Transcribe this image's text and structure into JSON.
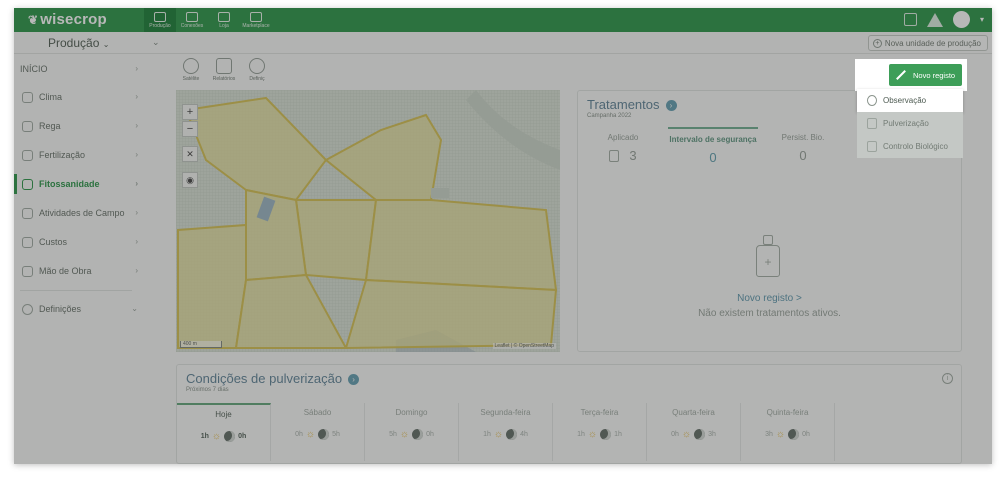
{
  "app": {
    "logo": "wisecrop",
    "nav": [
      {
        "label": "Produção",
        "icon": "home-icon"
      },
      {
        "label": "Conexões",
        "icon": "network-icon"
      },
      {
        "label": "Loja",
        "icon": "shop-icon"
      },
      {
        "label": "Marketplace",
        "icon": "marketplace-icon"
      }
    ]
  },
  "subbar": {
    "production_label": "Produção",
    "new_unit_label": "Nova unidade de produção"
  },
  "sidebar": {
    "inicio": "INÍCIO",
    "items": [
      {
        "label": "Clima"
      },
      {
        "label": "Rega"
      },
      {
        "label": "Fertilização"
      },
      {
        "label": "Fitossanidade"
      },
      {
        "label": "Atividades de Campo"
      },
      {
        "label": "Custos"
      },
      {
        "label": "Mão de Obra"
      }
    ],
    "settings": "Definições"
  },
  "map_tools": [
    {
      "label": "Satélite"
    },
    {
      "label": "Relatórios"
    },
    {
      "label": "Definiç"
    }
  ],
  "map": {
    "zoom_in": "+",
    "zoom_out": "−",
    "scale": "400 m",
    "attribution": "Leaflet | © OpenStreetMap"
  },
  "treatments": {
    "title": "Tratamentos",
    "subtitle": "Campanha 2022",
    "columns": [
      {
        "label": "Aplicado",
        "value": "3"
      },
      {
        "label": "Intervalo de segurança",
        "value": "0"
      },
      {
        "label": "Persist. Bio.",
        "value": "0"
      }
    ],
    "new_record_link": "Novo registo >",
    "empty_text": "Não existem tratamentos ativos."
  },
  "spray": {
    "title": "Condições de pulverização",
    "subtitle": "Próximos 7 dias",
    "days": [
      {
        "name": "Hoje",
        "day_hours": "1h",
        "night_hours": "0h"
      },
      {
        "name": "Sábado",
        "day_hours": "0h",
        "night_hours": "5h"
      },
      {
        "name": "Domingo",
        "day_hours": "5h",
        "night_hours": "0h"
      },
      {
        "name": "Segunda-feira",
        "day_hours": "1h",
        "night_hours": "4h"
      },
      {
        "name": "Terça-feira",
        "day_hours": "1h",
        "night_hours": "1h"
      },
      {
        "name": "Quarta-feira",
        "day_hours": "0h",
        "night_hours": "3h"
      },
      {
        "name": "Quinta-feira",
        "day_hours": "3h",
        "night_hours": "0h"
      }
    ]
  },
  "new_record": {
    "button_label": "Novo registo",
    "menu": [
      {
        "label": "Observação"
      },
      {
        "label": "Pulverização"
      },
      {
        "label": "Controlo Biológico"
      }
    ]
  },
  "colors": {
    "brand": "#3d9e58",
    "accent_blue": "#6d8ea0"
  }
}
